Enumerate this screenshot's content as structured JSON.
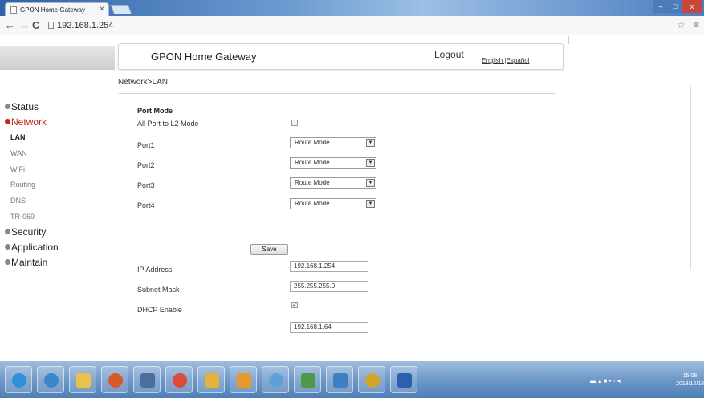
{
  "browser": {
    "tab_title": "GPON Home Gateway",
    "tab_close": "×",
    "url": "192.168.1.254",
    "back": "←",
    "forward": "→",
    "reload": "C",
    "star": "☆",
    "menu": "≡",
    "win_min": "–",
    "win_max": "□",
    "win_close": "x"
  },
  "header": {
    "title": "GPON Home Gateway",
    "logout": "Logout",
    "language": "English |Español"
  },
  "breadcrumb": "Network>LAN",
  "sidebar": {
    "sections": [
      {
        "label": "Status"
      },
      {
        "label": "Network"
      },
      {
        "label": "Security"
      },
      {
        "label": "Application"
      },
      {
        "label": "Maintain"
      }
    ],
    "network_items": [
      {
        "label": "LAN"
      },
      {
        "label": "WAN"
      },
      {
        "label": "WiFi"
      },
      {
        "label": "Routing"
      },
      {
        "label": "DNS"
      },
      {
        "label": "TR-069"
      }
    ]
  },
  "form": {
    "port_mode_heading": "Port Mode",
    "all_port_l2_label": "All Port to L2 Mode",
    "ports": [
      {
        "label": "Port1",
        "value": "Route Mode"
      },
      {
        "label": "Port2",
        "value": "Route Mode"
      },
      {
        "label": "Port3",
        "value": "Route Mode"
      },
      {
        "label": "Port4",
        "value": "Route Mode"
      }
    ],
    "save": "Save",
    "ip_address_label": "IP Address",
    "ip_address_value": "192.168.1.254",
    "subnet_mask_label": "Subnet Mask",
    "subnet_mask_value": "255.255.255.0",
    "dhcp_enable_label": "DHCP Enable",
    "dhcp_checked_mark": "✓",
    "dhcp_start_value": "192.168.1.64"
  },
  "taskbar": {
    "clock_time": "15:08",
    "clock_date": "2013/12/18"
  },
  "colors": {
    "active_red": "#c0281f",
    "taskbar_blue": "#6f98c8"
  }
}
